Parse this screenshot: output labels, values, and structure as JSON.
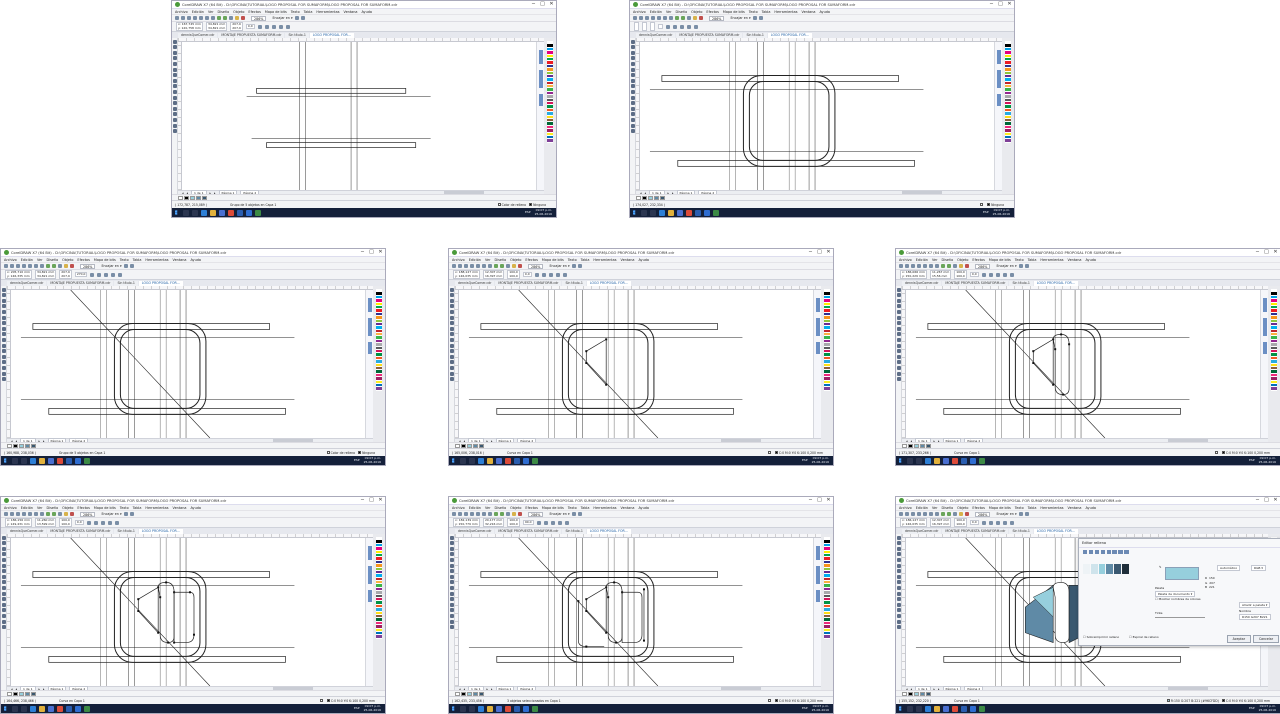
{
  "app": {
    "title": "CorelDRAW X7 (64 Bit) - D:\\OFICINA\\TUTORIAL\\LOGO PROPOSAL FOR SUMAFORM\\LOGO PROPOSAL FOR SUMAFORM.cdr",
    "menu": [
      "Archivo",
      "Edición",
      "Ver",
      "Diseño",
      "Objeto",
      "Efectos",
      "Mapa de bits",
      "Texto",
      "Tabla",
      "Herramientas",
      "Ventana",
      "Ayuda"
    ],
    "zoom": "286%",
    "snap_label": "Encajar en",
    "doc_tabs": [
      "dennisQueComer.cdr",
      "MONTAJE PROPUESTA SUMAFORM.cdr",
      "Sin título-1",
      "LOGO PROPOSAL FOR..."
    ],
    "pages": [
      "Página 1",
      "Página 2"
    ],
    "page_counter": "1 de 1",
    "outline": "C:0 M:0 Y:0 K:100  0,200 mm",
    "taskbar": {
      "time": "09:07 p.m.",
      "date": "25-06-2016",
      "lang": "ESP"
    }
  },
  "windows": [
    {
      "id": "w1",
      "step": "guides",
      "status": {
        "coords": "( 172,787, 215,089 )",
        "selection": "Grupo de 5 objetos en Capa 1",
        "fill": "Color de relleno",
        "outline": "Ninguna"
      },
      "props": {
        "x": "x: 167,745 mm",
        "y": "y: 120,758 mm",
        "w": "34,821 mm",
        "h": "34,821 mm",
        "scale": "207,9",
        "angle": "0,0"
      }
    },
    {
      "id": "w2",
      "step": "rounded-frame",
      "status": {
        "coords": "( 174,027, 232,334 )",
        "selection": "",
        "fill": "",
        "outline": "Ninguna"
      },
      "props": {
        "x": "",
        "y": "",
        "w": "",
        "h": "",
        "scale": "",
        "angle": ""
      }
    },
    {
      "id": "w3",
      "step": "frame-diagonal",
      "status": {
        "coords": "( 160,988, 238,036 )",
        "selection": "Grupo de 5 objetos en Capa 1",
        "fill": "Color de relleno",
        "outline": "Ninguna"
      },
      "props": {
        "x": "x: 205,710 mm",
        "y": "y: 146,335 mm",
        "w": "34,821 mm",
        "h": "34,821 mm",
        "scale": "207,9",
        "angle": "270,0"
      }
    },
    {
      "id": "w4",
      "step": "left-shape",
      "status": {
        "coords": "( 165,006, 238,016 )",
        "selection": "Curva en Capa 1",
        "fill": "",
        "outline": "C:0 M:0 Y:0 K:100  0,200 mm"
      },
      "props": {
        "x": "x: 188,127 mm",
        "y": "y: 146,035 mm",
        "w": "12,307 mm",
        "h": "16,397 mm",
        "scale": "100,0",
        "angle": "0,0"
      }
    },
    {
      "id": "w5",
      "step": "center-shape",
      "status": {
        "coords": "( 171,307, 233,266 )",
        "selection": "Curva en Capa 1",
        "fill": "",
        "outline": "C:0 M:0 Y:0 K:100  0,200 mm"
      },
      "props": {
        "x": "x: 186,066 mm",
        "y": "y: 150,229 mm",
        "w": "11,267 mm",
        "h": "15,56 mm",
        "scale": "100,0",
        "angle": "0,0"
      }
    },
    {
      "id": "w6",
      "step": "right-shape",
      "status": {
        "coords": "( 164,466, 238,466 )",
        "selection": "Curva en Capa 1",
        "fill": "",
        "outline": "C:0 M:0 Y:0 K:100  0,200 mm"
      },
      "props": {
        "x": "x: 186,156 mm",
        "y": "y: 149,431 mm",
        "w": "11,260 mm",
        "h": "13,599 mm",
        "scale": "100,0",
        "angle": "0,0"
      }
    },
    {
      "id": "w7",
      "step": "three-shapes",
      "status": {
        "coords": "( 162,435, 233,456 )",
        "selection": "3 objetos seleccionados en Capa 1",
        "fill": "",
        "outline": "C:0 M:0 Y:0 K:100  0,200 mm"
      },
      "props": {
        "x": "x: 182,139 mm",
        "y": "y: 150,779 mm",
        "w": "20,177 mm",
        "h": "32,216 mm",
        "scale": "100,0",
        "angle": "90,0"
      }
    },
    {
      "id": "w8",
      "step": "fill-dialog",
      "status": {
        "coords": "( 155,152, 232,220 )",
        "selection": "Curva en Capa 1",
        "fill": "R:150 G:207 B:221 (#96CFDD)",
        "outline": "C:0 M:0 Y:0 K:100  0,200 mm"
      },
      "props": {
        "x": "x: 186,127 mm",
        "y": "y: 146,035 mm",
        "w": "12,307 mm",
        "h": "16,397 mm",
        "scale": "100,0",
        "angle": "0,0"
      }
    }
  ],
  "fill_dialog": {
    "title": "Editor relleno",
    "model": "RGB",
    "mode_label": "Automático",
    "palette_label": "Paleta",
    "palette_value": "Paleta de documento",
    "show_names": "Mostrar nombres de colores",
    "tint_label": "Tinte",
    "name_label": "Nombre",
    "name_value": "R150 G207 B221",
    "add_label": "Añadir a paleta",
    "r": "150",
    "g": "207",
    "b": "221",
    "hex": "#96CFDD",
    "overprint": "Sobreimprimir relleno",
    "winding": "Espiral de relleno",
    "accept": "Aceptar",
    "cancel": "Cancelar"
  },
  "colors": {
    "accent": "#1f5fa5",
    "taskbar": "#14203a",
    "fill_light": "#96CFDD",
    "fill_mid": "#5f8aa6",
    "fill_dark": "#3a5870"
  },
  "palette_colors": [
    "#ffffff",
    "#000000",
    "#00a0e6",
    "#e6007e",
    "#ffed00",
    "#00a651",
    "#ed1c24",
    "#2e3192",
    "#f7941d",
    "#8dc63f",
    "#662d91",
    "#00aeef",
    "#c1272d",
    "#fbb040",
    "#39b54a",
    "#92278f",
    "#a7a9ac",
    "#58595b",
    "#d4145a",
    "#009245",
    "#f15a24",
    "#29abe2",
    "#ffde17",
    "#8b5e3c",
    "#006837",
    "#ee2a7b",
    "#9e1f63",
    "#fcee21",
    "#0071bc",
    "#7f3f98"
  ]
}
